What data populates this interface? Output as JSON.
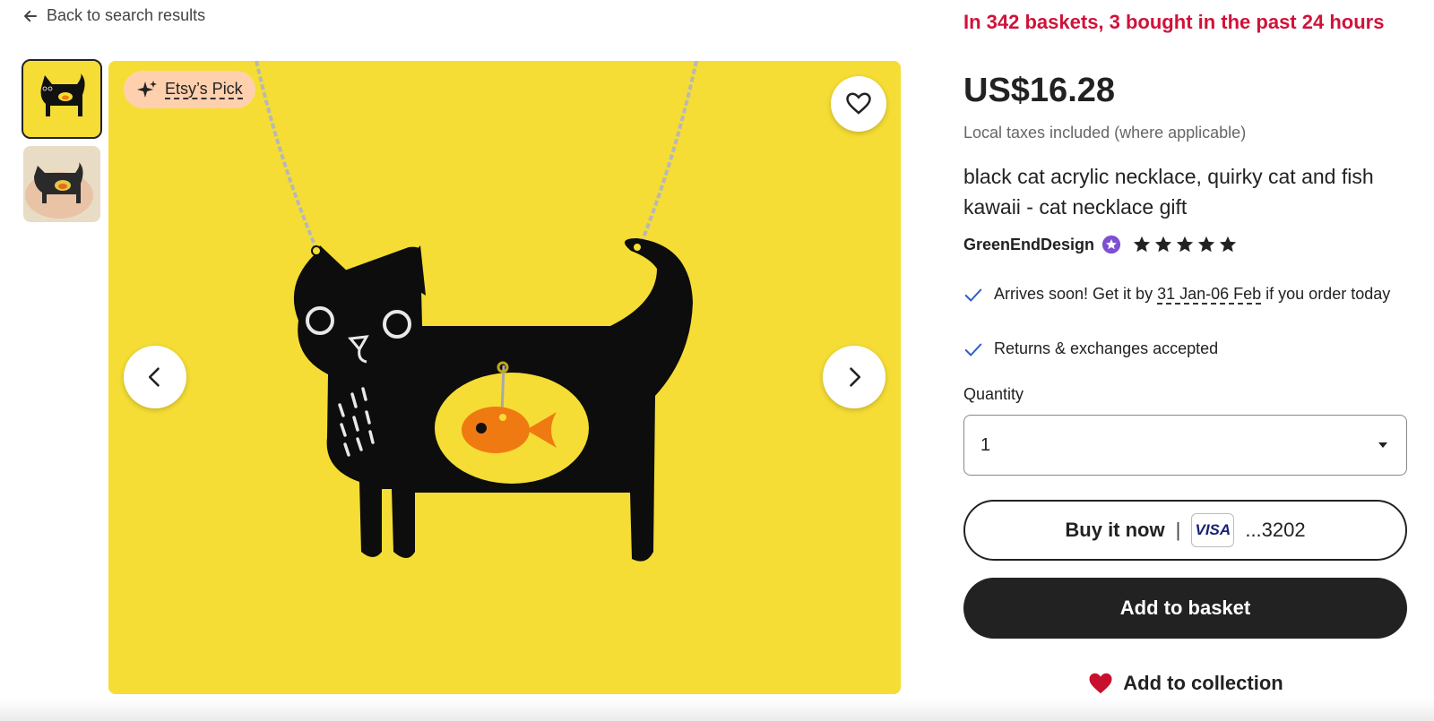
{
  "nav": {
    "back_label": "Back to search results",
    "back_icon": "arrow-left-icon"
  },
  "gallery": {
    "badge_label": "Etsy’s Pick",
    "badge_icon": "sparkle-icon",
    "favorite_icon": "heart-outline-icon",
    "prev_icon": "chevron-left-icon",
    "next_icon": "chevron-right-icon",
    "background_color": "#f5dd35",
    "thumbnails": [
      {
        "description_icon": "cat-necklace-thumbnail",
        "active": true
      },
      {
        "description_icon": "cat-necklace-hand-thumbnail",
        "active": false
      }
    ]
  },
  "product": {
    "social_proof": "In 342 baskets, 3 bought in the past 24 hours",
    "price": "US$16.28",
    "taxes_note": "Local taxes included (where applicable)",
    "title": "black cat acrylic necklace, quirky cat and fish kawaii - cat necklace gift",
    "seller_name": "GreenEndDesign",
    "rating_stars": 5,
    "perks": [
      {
        "prefix": "Arrives soon! Get it by ",
        "highlight": "31 Jan-06 Feb",
        "suffix": " if you order today"
      },
      {
        "text": "Returns & exchanges accepted"
      }
    ]
  },
  "purchase": {
    "quantity_label": "Quantity",
    "quantity_value": "1",
    "buy_now_label": "Buy it now",
    "buy_now_separator": "|",
    "card_brand": "VISA",
    "card_suffix": "...3202",
    "add_basket_label": "Add to basket",
    "add_collection_label": "Add to collection"
  },
  "colors": {
    "accent_red": "#d0123a",
    "primary_dark": "#222222",
    "badge_bg": "#ffd0ad",
    "heart_red": "#c8102e"
  }
}
